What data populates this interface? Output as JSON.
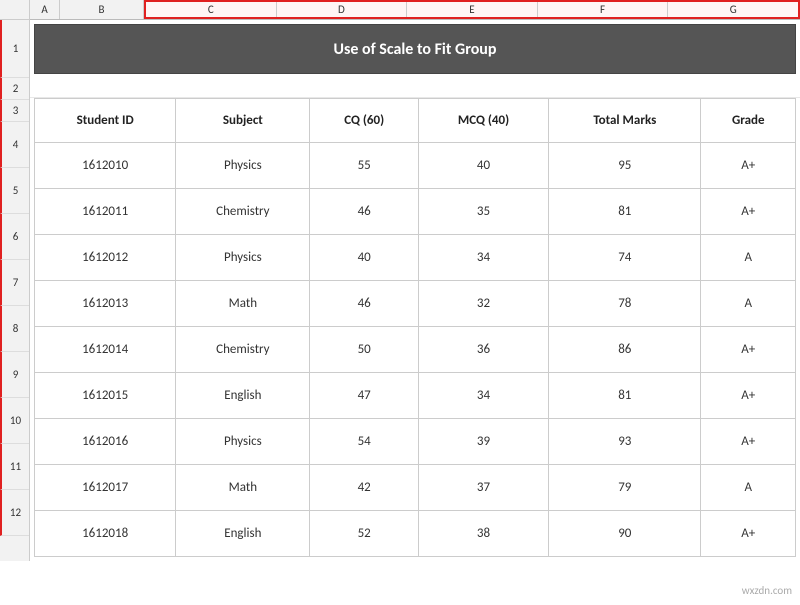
{
  "header": {
    "corner": "",
    "columns": [
      "A",
      "B",
      "C",
      "D",
      "E",
      "F",
      "G"
    ]
  },
  "title": "Use of Scale to Fit Group",
  "row_numbers": [
    "1",
    "2",
    "3",
    "4",
    "5",
    "6",
    "7",
    "8",
    "9",
    "10",
    "11",
    "12"
  ],
  "table": {
    "headers": [
      "Student ID",
      "Subject",
      "CQ (60)",
      "MCQ (40)",
      "Total Marks",
      "Grade"
    ],
    "rows": [
      {
        "id": "1612010",
        "subject": "Physics",
        "cq": "55",
        "mcq": "40",
        "total": "95",
        "grade": "A+"
      },
      {
        "id": "1612011",
        "subject": "Chemistry",
        "cq": "46",
        "mcq": "35",
        "total": "81",
        "grade": "A+"
      },
      {
        "id": "1612012",
        "subject": "Physics",
        "cq": "40",
        "mcq": "34",
        "total": "74",
        "grade": "A"
      },
      {
        "id": "1612013",
        "subject": "Math",
        "cq": "46",
        "mcq": "32",
        "total": "78",
        "grade": "A"
      },
      {
        "id": "1612014",
        "subject": "Chemistry",
        "cq": "50",
        "mcq": "36",
        "total": "86",
        "grade": "A+"
      },
      {
        "id": "1612015",
        "subject": "English",
        "cq": "47",
        "mcq": "34",
        "total": "81",
        "grade": "A+"
      },
      {
        "id": "1612016",
        "subject": "Physics",
        "cq": "54",
        "mcq": "39",
        "total": "93",
        "grade": "A+"
      },
      {
        "id": "1612017",
        "subject": "Math",
        "cq": "42",
        "mcq": "37",
        "total": "79",
        "grade": "A"
      },
      {
        "id": "1612018",
        "subject": "English",
        "cq": "52",
        "mcq": "38",
        "total": "90",
        "grade": "A+"
      }
    ]
  },
  "watermark": "wxzdn.com"
}
